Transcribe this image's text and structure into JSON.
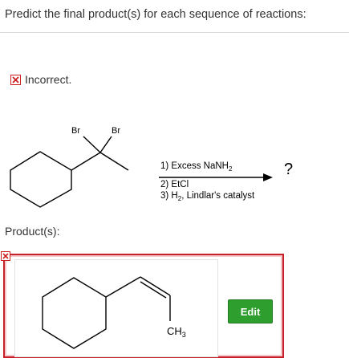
{
  "question": {
    "text": "Predict the final product(s) for each sequence of reactions:"
  },
  "status": {
    "icon": "incorrect-x-icon",
    "text": "Incorrect.",
    "color": "#cc1f1f"
  },
  "reaction": {
    "substituents": [
      "Br",
      "Br"
    ],
    "step1": "1) Excess NaNH",
    "step1_sub": "2",
    "step2": "2) EtCl",
    "step3_pre": "3) H",
    "step3_sub": "2",
    "step3_post": ", Lindlar's catalyst",
    "unknown_product": "?"
  },
  "product": {
    "label": "Product(s):",
    "methyl_label": "CH",
    "methyl_sub": "3",
    "edit_button": "Edit",
    "edit_color": "#2e9e2e",
    "frame_color": "#c8202a"
  }
}
